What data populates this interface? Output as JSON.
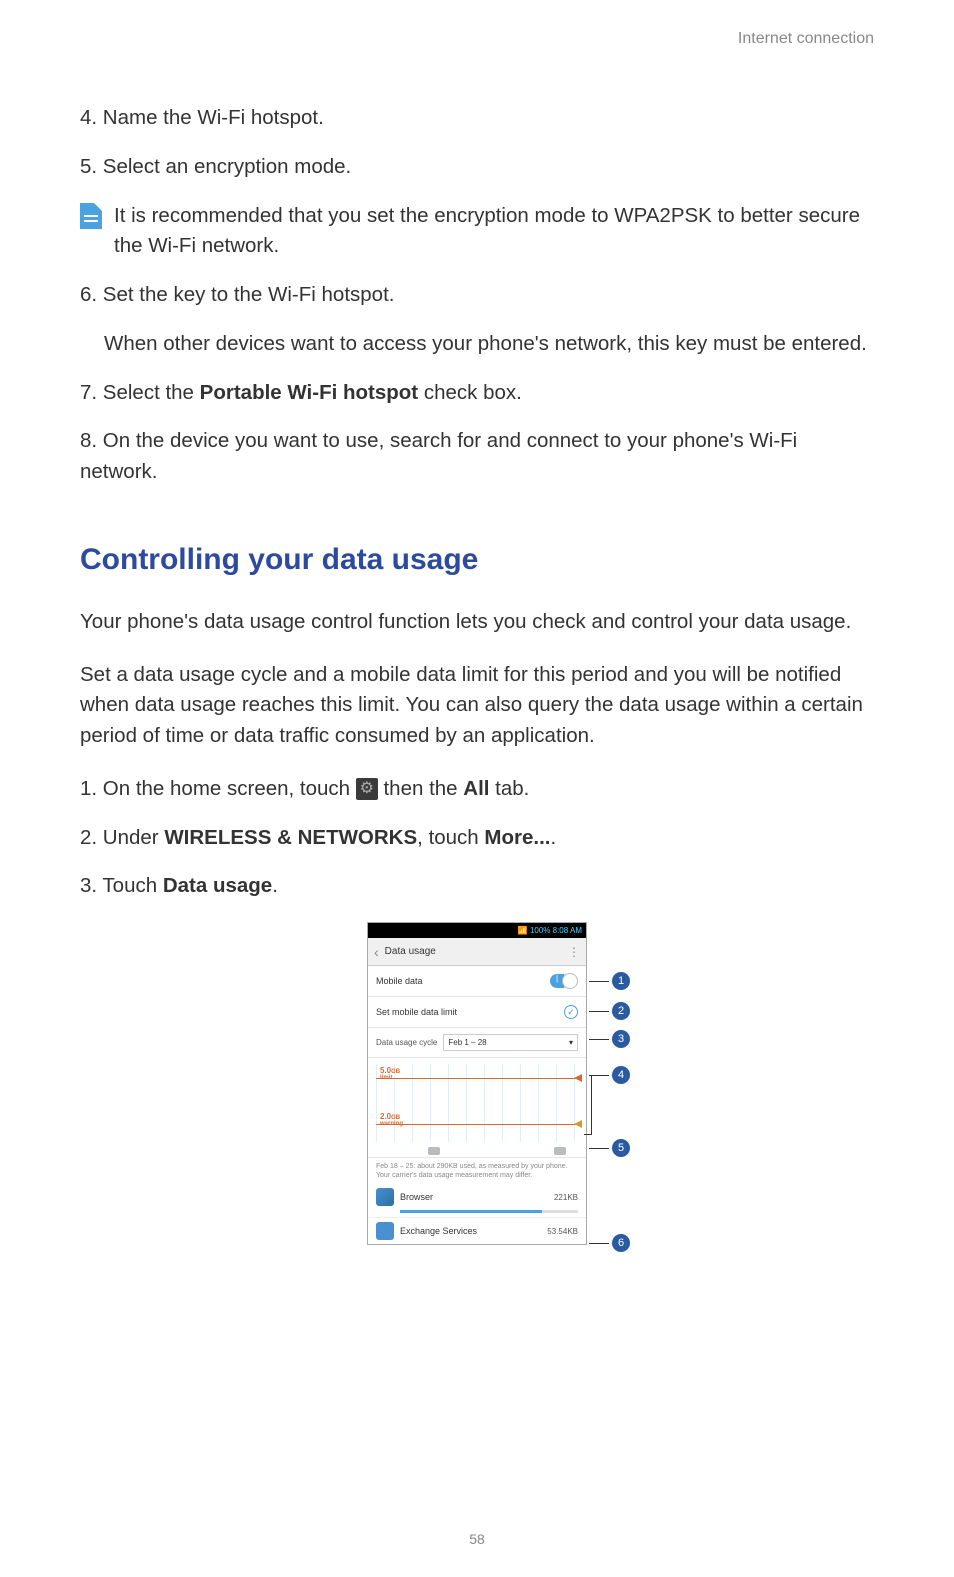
{
  "header": "Internet connection",
  "steps": {
    "s4": "4. Name the Wi-Fi hotspot.",
    "s5": "5. Select an encryption mode.",
    "note": "It is recommended that you set the encryption mode to WPA2PSK to better secure the Wi-Fi network.",
    "s6": "6. Set the key to the Wi-Fi hotspot.",
    "s6b": "When other devices want to access your phone's network, this key must be entered.",
    "s7_pre": "7. Select the ",
    "s7_bold": "Portable Wi-Fi hotspot",
    "s7_post": " check box.",
    "s8": "8. On the device you want to use, search for and connect to your phone's Wi-Fi network."
  },
  "section_title": "Controlling your data usage",
  "para1": "Your phone's data usage control function lets you check and control your data usage.",
  "para2": "Set a data usage cycle and a mobile data limit for this period and you will be notified when data usage reaches this limit. You can also query the data usage within a certain period of time or data traffic consumed by an application.",
  "steps2": {
    "s1_pre": "1. On the home screen, touch ",
    "s1_mid": " then the ",
    "s1_bold": "All",
    "s1_post": " tab.",
    "s2_pre": "2. Under ",
    "s2_bold1": "WIRELESS & NETWORKS",
    "s2_mid": ", touch ",
    "s2_bold2": "More...",
    "s2_post": ".",
    "s3_pre": "3. Touch ",
    "s3_bold": "Data usage",
    "s3_post": "."
  },
  "phone": {
    "status_time": "100%  8:08 AM",
    "title": "Data usage",
    "mobile_data": "Mobile data",
    "set_limit": "Set mobile data limit",
    "cycle_label": "Data usage cycle",
    "cycle_value": "Feb 1 – 28",
    "limit_val": "5.0",
    "limit_unit": "GB",
    "limit_text": "limit",
    "warn_val": "2.0",
    "warn_unit": "GB",
    "warn_text": "warning",
    "usage_note": "Feb 18 – 25: about 290KB used, as measured by your phone. Your carrier's data usage measurement may differ.",
    "app1_name": "Browser",
    "app1_size": "221KB",
    "app2_name": "Exchange Services",
    "app2_size": "53.54KB"
  },
  "callouts": [
    "1",
    "2",
    "3",
    "4",
    "5",
    "6"
  ],
  "page_num": "58"
}
